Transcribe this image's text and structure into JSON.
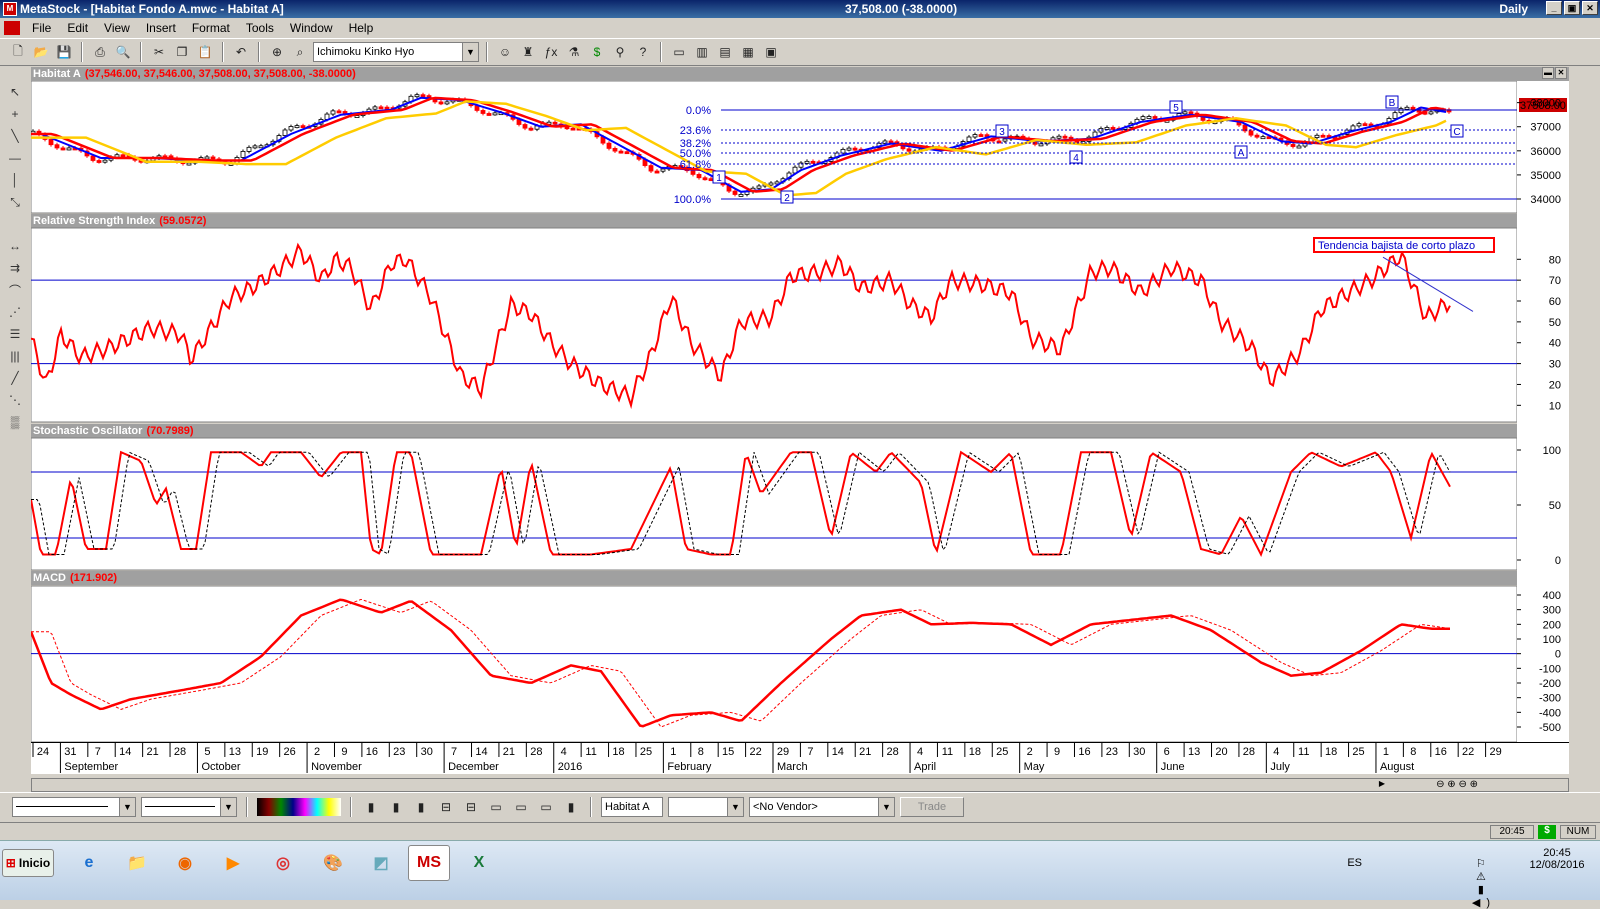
{
  "window": {
    "title": "MetaStock - [Habitat Fondo A.mwc - Habitat A]",
    "quote": "37,508.00 (-38.0000)",
    "period": "Daily"
  },
  "menu": [
    "File",
    "Edit",
    "View",
    "Insert",
    "Format",
    "Tools",
    "Window",
    "Help"
  ],
  "toolbar": {
    "indicator_combo": "Ichimoku Kinko Hyo"
  },
  "panes": {
    "price": {
      "title": "Habitat A",
      "value": "(37,546.00, 37,546.00, 37,508.00, 37,508.00, -38.0000)",
      "last_price": "37508.00",
      "y_ticks": [
        "38000",
        "37000",
        "36000",
        "35000",
        "34000"
      ],
      "fib": [
        "0.0%",
        "23.6%",
        "38.2%",
        "50.0%",
        "61.8%",
        "100.0%"
      ],
      "waves": [
        "1",
        "2",
        "3",
        "4",
        "5",
        "A",
        "B",
        "C"
      ]
    },
    "rsi": {
      "title": "Relative Strength Index",
      "value": "(59.0572)",
      "annotation": "Tendencia bajista de corto plazo",
      "y_ticks": [
        "80",
        "70",
        "60",
        "50",
        "40",
        "30",
        "20",
        "10"
      ]
    },
    "stoch": {
      "title": "Stochastic Oscillator",
      "value": "(70.7989)",
      "y_ticks": [
        "100",
        "50",
        "0"
      ]
    },
    "macd": {
      "title": "MACD",
      "value": "(171.902)",
      "y_ticks": [
        "400",
        "300",
        "200",
        "100",
        "0",
        "-100",
        "-200",
        "-300",
        "-400",
        "-500"
      ]
    }
  },
  "xaxis": {
    "days": [
      "24",
      "31",
      "7",
      "14",
      "21",
      "28",
      "5",
      "13",
      "19",
      "26",
      "2",
      "9",
      "16",
      "23",
      "30",
      "7",
      "14",
      "21",
      "28",
      "4",
      "11",
      "18",
      "25",
      "1",
      "8",
      "15",
      "22",
      "29",
      "7",
      "14",
      "21",
      "28",
      "4",
      "11",
      "18",
      "25",
      "2",
      "9",
      "16",
      "23",
      "30",
      "6",
      "13",
      "20",
      "28",
      "4",
      "11",
      "18",
      "25",
      "1",
      "8",
      "16",
      "22",
      "29"
    ],
    "months": [
      "September",
      "October",
      "November",
      "December",
      "2016",
      "February",
      "March",
      "April",
      "May",
      "June",
      "July",
      "August"
    ]
  },
  "bottom": {
    "security": "Habitat A",
    "vendor": "<No Vendor>",
    "trade": "Trade"
  },
  "status": {
    "time": "20:45",
    "currency": "$",
    "num": "NUM"
  },
  "taskbar": {
    "start": "Inicio",
    "lang": "ES",
    "clock_time": "20:45",
    "clock_date": "12/08/2016"
  },
  "colors": {
    "bars": "#ff0000",
    "ema_blue": "#0000ff",
    "ema_red": "#ff0000",
    "ema_yellow": "#ffcc00",
    "hline": "#0000cc"
  }
}
